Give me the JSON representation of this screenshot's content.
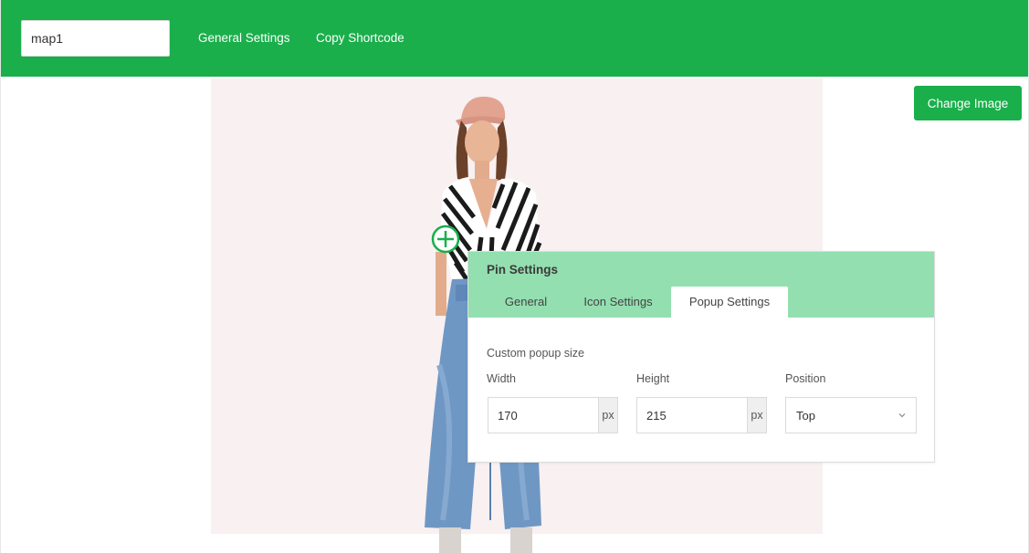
{
  "topbar": {
    "map_name_value": "map1",
    "nav": {
      "general_settings": "General Settings",
      "copy_shortcode": "Copy Shortcode"
    }
  },
  "canvas": {
    "change_image_label": "Change Image"
  },
  "pin": {
    "icon": "plus-circle-icon"
  },
  "popup": {
    "title": "Pin Settings",
    "tabs": [
      {
        "label": "General",
        "active": false
      },
      {
        "label": "Icon Settings",
        "active": false
      },
      {
        "label": "Popup Settings",
        "active": true
      }
    ],
    "custom_size_label": "Custom popup size",
    "width": {
      "label": "Width",
      "value": "170",
      "unit": "px"
    },
    "height": {
      "label": "Height",
      "value": "215",
      "unit": "px"
    },
    "position": {
      "label": "Position",
      "value": "Top",
      "icon": "chevron-down-icon"
    }
  },
  "colors": {
    "brand_green": "#1aaf4b",
    "tab_bar_green": "#93dfb0",
    "canvas_bg": "#f8f0f1"
  }
}
